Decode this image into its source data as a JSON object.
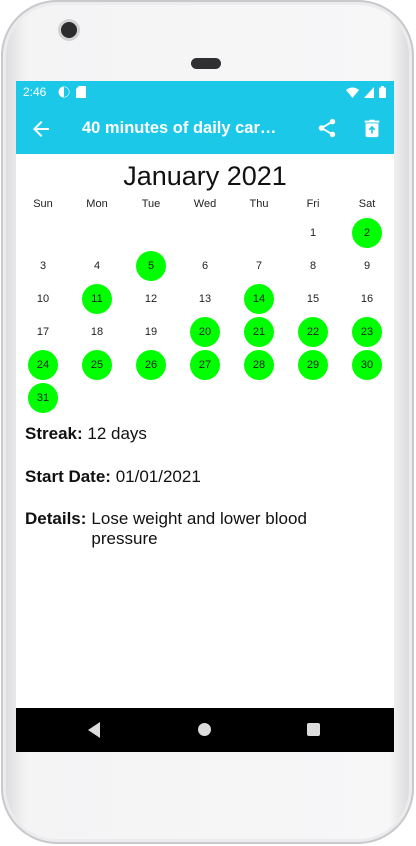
{
  "status_bar": {
    "time": "2:46"
  },
  "app_bar": {
    "title": "40 minutes of daily car…"
  },
  "calendar": {
    "month_title": "January 2021",
    "weekdays": [
      "Sun",
      "Mon",
      "Tue",
      "Wed",
      "Thu",
      "Fri",
      "Sat"
    ],
    "days": [
      {
        "label": "1",
        "col": 5,
        "row": 0,
        "done": false
      },
      {
        "label": "2",
        "col": 6,
        "row": 0,
        "done": true
      },
      {
        "label": "3",
        "col": 0,
        "row": 1,
        "done": false
      },
      {
        "label": "4",
        "col": 1,
        "row": 1,
        "done": false
      },
      {
        "label": "5",
        "col": 2,
        "row": 1,
        "done": true
      },
      {
        "label": "6",
        "col": 3,
        "row": 1,
        "done": false
      },
      {
        "label": "7",
        "col": 4,
        "row": 1,
        "done": false
      },
      {
        "label": "8",
        "col": 5,
        "row": 1,
        "done": false
      },
      {
        "label": "9",
        "col": 6,
        "row": 1,
        "done": false
      },
      {
        "label": "10",
        "col": 0,
        "row": 2,
        "done": false
      },
      {
        "label": "11",
        "col": 1,
        "row": 2,
        "done": true
      },
      {
        "label": "12",
        "col": 2,
        "row": 2,
        "done": false
      },
      {
        "label": "13",
        "col": 3,
        "row": 2,
        "done": false
      },
      {
        "label": "14",
        "col": 4,
        "row": 2,
        "done": true
      },
      {
        "label": "15",
        "col": 5,
        "row": 2,
        "done": false
      },
      {
        "label": "16",
        "col": 6,
        "row": 2,
        "done": false
      },
      {
        "label": "17",
        "col": 0,
        "row": 3,
        "done": false
      },
      {
        "label": "18",
        "col": 1,
        "row": 3,
        "done": false
      },
      {
        "label": "19",
        "col": 2,
        "row": 3,
        "done": false
      },
      {
        "label": "20",
        "col": 3,
        "row": 3,
        "done": true
      },
      {
        "label": "21",
        "col": 4,
        "row": 3,
        "done": true
      },
      {
        "label": "22",
        "col": 5,
        "row": 3,
        "done": true
      },
      {
        "label": "23",
        "col": 6,
        "row": 3,
        "done": true
      },
      {
        "label": "24",
        "col": 0,
        "row": 4,
        "done": true
      },
      {
        "label": "25",
        "col": 1,
        "row": 4,
        "done": true
      },
      {
        "label": "26",
        "col": 2,
        "row": 4,
        "done": true
      },
      {
        "label": "27",
        "col": 3,
        "row": 4,
        "done": true
      },
      {
        "label": "28",
        "col": 4,
        "row": 4,
        "done": true
      },
      {
        "label": "29",
        "col": 5,
        "row": 4,
        "done": true
      },
      {
        "label": "30",
        "col": 6,
        "row": 4,
        "done": true
      },
      {
        "label": "31",
        "col": 0,
        "row": 5,
        "done": true
      }
    ],
    "done_color": "#00ff00"
  },
  "details": {
    "streak_label": "Streak:",
    "streak_value": "12 days",
    "start_label": "Start Date:",
    "start_value": "01/01/2021",
    "details_label": "Details:",
    "details_value": "Lose weight and lower blood pressure"
  },
  "icons": {
    "back": "arrow-left-icon",
    "share": "share-icon",
    "delete": "trash-icon"
  },
  "colors": {
    "primary": "#1cc8e8",
    "navbar": "#000000"
  }
}
